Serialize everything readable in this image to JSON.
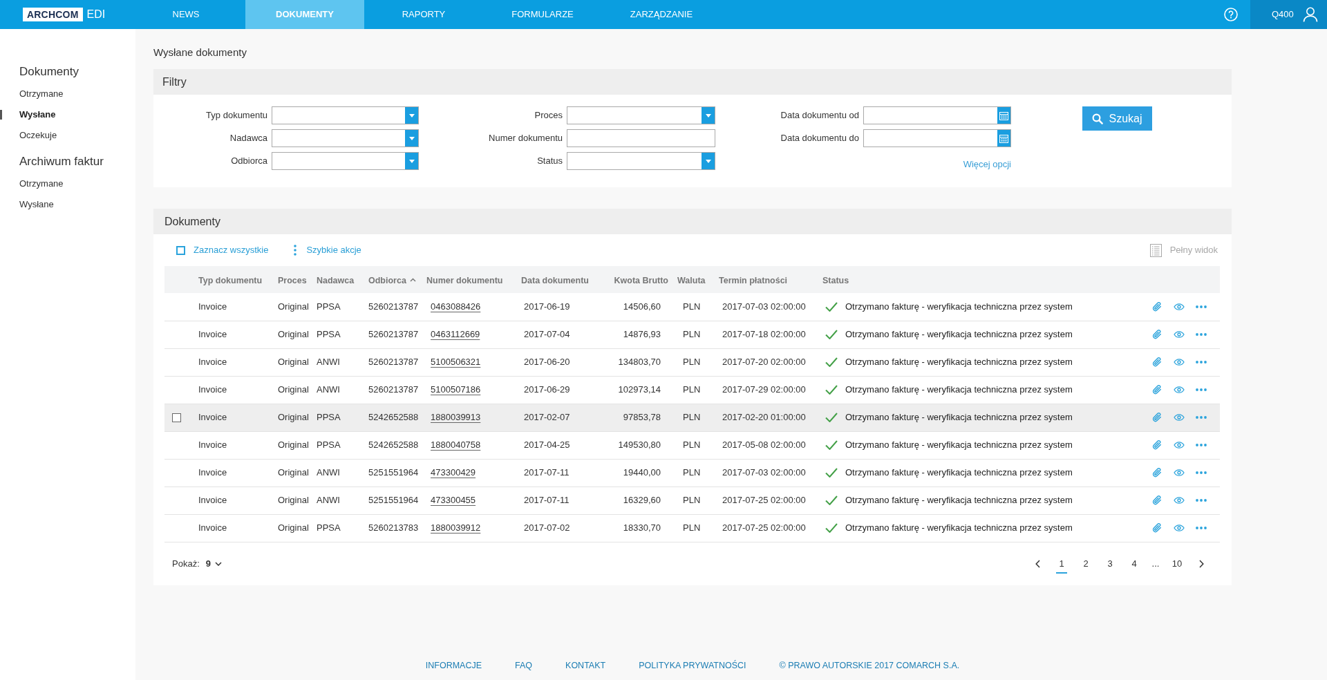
{
  "header": {
    "logo": {
      "brand": "ARCHCOM",
      "product": "EDI"
    },
    "nav": [
      {
        "label": "NEWS",
        "selected": false
      },
      {
        "label": "DOKUMENTY",
        "selected": true
      },
      {
        "label": "RAPORTY",
        "selected": false
      },
      {
        "label": "FORMULARZE",
        "selected": false
      },
      {
        "label": "ZARZĄDZANIE",
        "selected": false
      }
    ],
    "user": "Q400"
  },
  "sidebar": {
    "sections": [
      {
        "title": "Dokumenty",
        "items": [
          {
            "label": "Otrzymane",
            "selected": false
          },
          {
            "label": "Wysłane",
            "selected": true
          },
          {
            "label": "Oczekuje",
            "selected": false
          }
        ]
      },
      {
        "title": "Archiwum faktur",
        "items": [
          {
            "label": "Otrzymane",
            "selected": false
          },
          {
            "label": "Wysłane",
            "selected": false
          }
        ]
      }
    ]
  },
  "page_title": "Wysłane dokumenty",
  "filters": {
    "title": "Filtry",
    "columns": [
      {
        "fields": [
          {
            "label": "Typ dokumentu",
            "kind": "select"
          },
          {
            "label": "Nadawca",
            "kind": "select"
          },
          {
            "label": "Odbiorca",
            "kind": "select"
          }
        ]
      },
      {
        "fields": [
          {
            "label": "Proces",
            "kind": "select"
          },
          {
            "label": "Numer dokumentu",
            "kind": "text"
          },
          {
            "label": "Status",
            "kind": "select"
          }
        ]
      },
      {
        "fields": [
          {
            "label": "Data dokumentu od",
            "kind": "date"
          },
          {
            "label": "Data dokumentu do",
            "kind": "date"
          }
        ],
        "link": "Więcej opcji"
      }
    ],
    "search_button": "Szukaj"
  },
  "documents": {
    "title": "Dokumenty",
    "select_all": {
      "label": "Zaznacz wszystkie",
      "checked": false
    },
    "quick_actions": "Szybkie akcje",
    "full_view": {
      "label": "Pełny widok",
      "disabled": true
    },
    "columns": [
      {
        "label": "Typ dokumentu",
        "kind": "text",
        "sorted": false
      },
      {
        "label": "Proces",
        "kind": "text",
        "sorted": false
      },
      {
        "label": "Nadawca",
        "kind": "text",
        "sorted": false
      },
      {
        "label": "Odbiorca",
        "kind": "text",
        "sorted": true
      },
      {
        "label": "Numer dokumentu",
        "kind": "link",
        "sorted": false
      },
      {
        "label": "Data dokumentu",
        "kind": "date",
        "sorted": false
      },
      {
        "label": "Kwota Brutto",
        "kind": "amount",
        "sorted": false
      },
      {
        "label": "Waluta",
        "kind": "currency",
        "sorted": false
      },
      {
        "label": "Termin płatności",
        "kind": "datetime",
        "sorted": false
      },
      {
        "label": "Status",
        "kind": "status",
        "sorted": false
      }
    ],
    "rows": [
      {
        "cells": [
          "Invoice",
          "Original",
          "PPSA",
          "5260213787",
          "0463088426",
          "2017-06-19",
          "14506,60",
          "PLN",
          "2017-07-03 02:00:00",
          "Otrzymano fakturę - weryfikacja techniczna przez system"
        ],
        "hovered": false
      },
      {
        "cells": [
          "Invoice",
          "Original",
          "PPSA",
          "5260213787",
          "0463112669",
          "2017-07-04",
          "14876,93",
          "PLN",
          "2017-07-18 02:00:00",
          "Otrzymano fakturę - weryfikacja techniczna przez system"
        ],
        "hovered": false
      },
      {
        "cells": [
          "Invoice",
          "Original",
          "ANWI",
          "5260213787",
          "5100506321",
          "2017-06-20",
          "134803,70",
          "PLN",
          "2017-07-20 02:00:00",
          "Otrzymano fakturę - weryfikacja techniczna przez system"
        ],
        "hovered": false
      },
      {
        "cells": [
          "Invoice",
          "Original",
          "ANWI",
          "5260213787",
          "5100507186",
          "2017-06-29",
          "102973,14",
          "PLN",
          "2017-07-29 02:00:00",
          "Otrzymano fakturę - weryfikacja techniczna przez system"
        ],
        "hovered": false
      },
      {
        "cells": [
          "Invoice",
          "Original",
          "PPSA",
          "5242652588",
          "1880039913",
          "2017-02-07",
          "97853,78",
          "PLN",
          "2017-02-20 01:00:00",
          "Otrzymano fakturę - weryfikacja techniczna przez system"
        ],
        "hovered": true
      },
      {
        "cells": [
          "Invoice",
          "Original",
          "PPSA",
          "5242652588",
          "1880040758",
          "2017-04-25",
          "149530,80",
          "PLN",
          "2017-05-08 02:00:00",
          "Otrzymano fakturę - weryfikacja techniczna przez system"
        ],
        "hovered": false
      },
      {
        "cells": [
          "Invoice",
          "Original",
          "ANWI",
          "5251551964",
          "473300429",
          "2017-07-11",
          "19440,00",
          "PLN",
          "2017-07-03 02:00:00",
          "Otrzymano fakturę - weryfikacja techniczna przez system"
        ],
        "hovered": false
      },
      {
        "cells": [
          "Invoice",
          "Original",
          "ANWI",
          "5251551964",
          "473300455",
          "2017-07-11",
          "16329,60",
          "PLN",
          "2017-07-25 02:00:00",
          "Otrzymano fakturę - weryfikacja techniczna przez system"
        ],
        "hovered": false
      },
      {
        "cells": [
          "Invoice",
          "Original",
          "PPSA",
          "5260213783",
          "1880039912",
          "2017-07-02",
          "18330,70",
          "PLN",
          "2017-07-25 02:00:00",
          "Otrzymano fakturę - weryfikacja techniczna przez system"
        ],
        "hovered": false
      }
    ],
    "pagination": {
      "page_size_label": "Pokaż:",
      "page_size": "9",
      "pages": [
        {
          "kind": "page",
          "label": "1",
          "selected": true
        },
        {
          "kind": "page",
          "label": "2",
          "selected": false
        },
        {
          "kind": "page",
          "label": "3",
          "selected": false
        },
        {
          "kind": "page",
          "label": "4",
          "selected": false
        },
        {
          "kind": "ellipsis",
          "label": "..."
        },
        {
          "kind": "page",
          "label": "10",
          "selected": false
        }
      ]
    }
  },
  "footer": {
    "links": [
      "INFORMACJE",
      "FAQ",
      "KONTAKT",
      "POLITYKA PRYWATNOŚCI"
    ],
    "copyright": "© PRAWO AUTORSKIE 2017 COMARCH S.A."
  }
}
